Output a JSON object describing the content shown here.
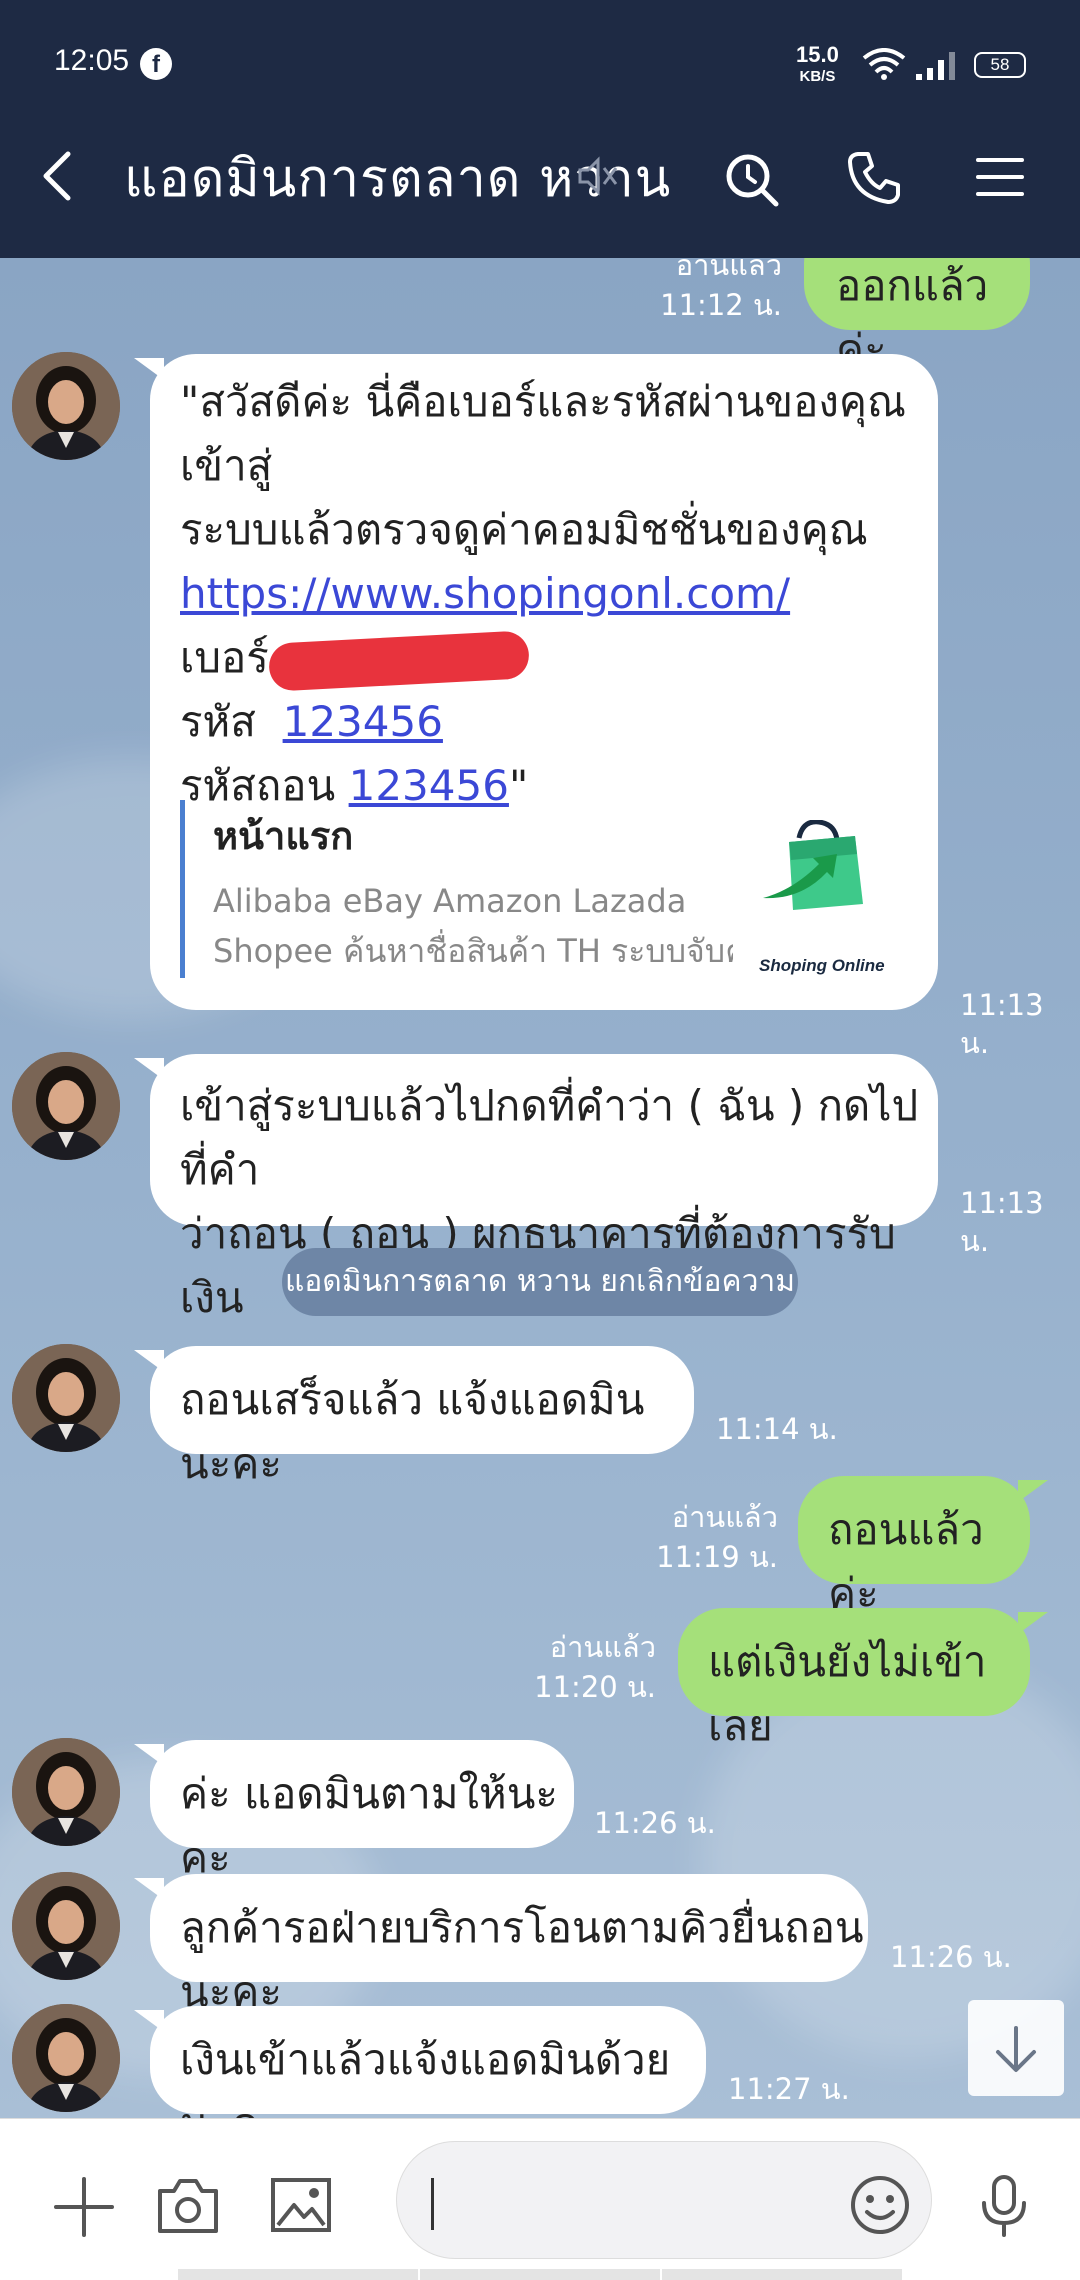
{
  "status_bar": {
    "time": "12:05",
    "net_speed_value": "15.0",
    "net_speed_unit": "KB/S",
    "battery": "58"
  },
  "header": {
    "title": "แอดมินการตลาด หวาน"
  },
  "messages": {
    "m0": {
      "text": "ออกแล้วค่ะ",
      "read": "อ่านแล้ว",
      "time": "11:12 น."
    },
    "m1": {
      "line1": "\"สวัสดีค่ะ นี่คือเบอร์และรหัสผ่านของคุณ เข้าสู่",
      "line2": "ระบบแล้วตรวจดูค่าคอมมิชชั่นของคุณ",
      "url": "https://www.shopingonl.com/",
      "phone_label": "เบอร์",
      "pass_label": "รหัส",
      "pass_value": "123456",
      "withdraw_label": "รหัสถอน",
      "withdraw_value": "123456",
      "closing_quote": "\"",
      "preview_title": "หน้าแรก",
      "preview_desc1": "Alibaba eBay Amazon Lazada",
      "preview_desc2": "Shopee ค้นหาชื่อสินค้า TH ระบบจับคู่อ...",
      "preview_logo_text": "Shoping Online",
      "time": "11:13 น."
    },
    "m2": {
      "line1": "เข้าสู่ระบบแล้วไปกดที่คำว่า ( ฉัน ) กดไปที่คำ",
      "line2": "ว่าถอน  ( ถอน ) ผูกธนาคารที่ต้องการรับเงิน",
      "time": "11:13 น."
    },
    "system": "แอดมินการตลาด หวาน ยกเลิกข้อความ",
    "m3": {
      "text": "ถอนเสร็จแล้ว แจ้งแอดมินนะคะ",
      "time": "11:14 น."
    },
    "m4": {
      "text": "ถอนแล้วค่ะ",
      "read": "อ่านแล้ว",
      "time": "11:19 น."
    },
    "m5": {
      "text": "แต่เงินยังไม่เข้าเลย",
      "read": "อ่านแล้ว",
      "time": "11:20 น."
    },
    "m6": {
      "text": "ค่ะ แอดมินตามให้นะคะ",
      "time": "11:26 น."
    },
    "m7": {
      "text": "ลูกค้ารอฝ่ายบริการโอนตามคิวยื่นถอนนะคะ",
      "time": "11:26 น."
    },
    "m8": {
      "text": "เงินเข้าแล้วแจ้งแอดมินด้วยนะคะ",
      "time": "11:27 น."
    }
  },
  "colors": {
    "header_bg": "#1e2a44",
    "outgoing_bubble": "#a5e07a",
    "incoming_bubble": "#ffffff",
    "link": "#3b48d6"
  },
  "icons": [
    "back-icon",
    "mute-icon",
    "search-icon",
    "call-icon",
    "menu-icon",
    "chevron-down-icon",
    "plus-icon",
    "camera-icon",
    "image-icon",
    "emoji-icon",
    "mic-icon"
  ]
}
